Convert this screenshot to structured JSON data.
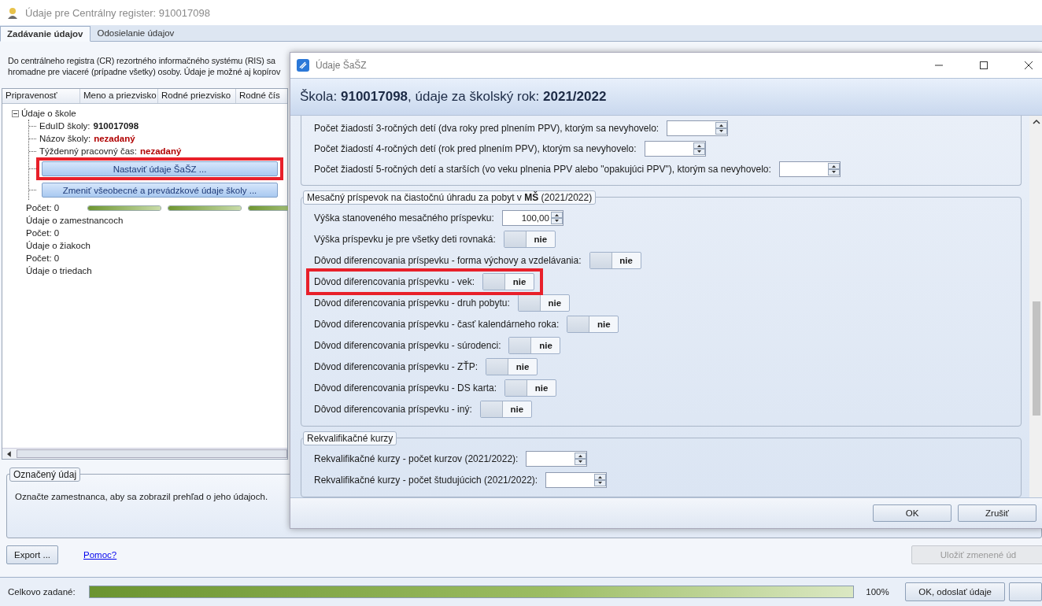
{
  "window": {
    "title": "Údaje pre Centrálny register: 910017098"
  },
  "tabs": [
    {
      "label": "Zadávanie údajov",
      "selected": true
    },
    {
      "label": "Odosielanie údajov",
      "selected": false
    }
  ],
  "description": [
    "Do centrálneho registra (CR) rezortného informačného systému (RIS) sa",
    "hromadne pre viaceré (prípadne všetky) osoby. Údaje je možné aj kopírov"
  ],
  "grid": {
    "columns": [
      "Pripravenosť",
      "Meno a priezvisko",
      "Rodné priezvisko",
      "Rodné čís"
    ],
    "tree": {
      "label": "Údaje o škole",
      "expanded": true,
      "children": [
        {
          "label": "EduID školy:",
          "value": "910017098",
          "missing": false
        },
        {
          "label": "Názov školy:",
          "value": "nezadaný",
          "missing": true
        },
        {
          "label": "Týždenný pracovný čas:",
          "value": "nezadaný",
          "missing": true
        }
      ],
      "buttons": [
        {
          "label": "Nastaviť údaje ŠaŠZ ...",
          "highlighted": true
        },
        {
          "label": "Zmeniť všeobecné a prevádzkové údaje školy ...",
          "highlighted": false
        }
      ]
    },
    "rows": [
      {
        "label": "Počet: 0",
        "bars": [
          {
            "level": 1
          },
          {
            "level": 1
          },
          {
            "level": 1
          }
        ]
      },
      {
        "label": "Údaje o zamestnancoch"
      },
      {
        "label": "Počet: 0"
      },
      {
        "label": "Údaje o žiakoch"
      },
      {
        "label": "Počet: 0"
      },
      {
        "label": "Údaje o triedach"
      }
    ]
  },
  "selected_info": {
    "legend": "Označený údaj",
    "text": "Označte zamestnanca, aby sa zobrazil prehľad o jeho údajoch."
  },
  "actions": {
    "export": "Export ...",
    "help": "Pomoc?",
    "save": {
      "label": "Uložiť zmenené úd",
      "disabled": true
    }
  },
  "status": {
    "label": "Celkovo zadané:",
    "level": 1,
    "reading": "100%",
    "send": "OK, odoslať údaje"
  },
  "dialog": {
    "title": "Údaje ŠaŠZ",
    "heading": "Škola: **910017098**, údaje za školský rok: **2021/2022**",
    "groups": [
      {
        "rows": [
          {
            "kind": "number",
            "label": "Počet žiadostí 3-ročných detí (dva roky pred plnením PPV), ktorým sa nevyhovelo:",
            "value": null,
            "highlighted": false
          },
          {
            "kind": "number",
            "label": "Počet žiadostí 4-ročných detí (rok pred plnením PPV), ktorým sa nevyhovelo:",
            "value": null,
            "highlighted": false
          },
          {
            "kind": "number",
            "label": "Počet žiadostí 5-ročných detí a starších (vo veku plnenia PPV alebo \"opakujúci PPV\"), ktorým sa nevyhovelo:",
            "value": null,
            "highlighted": false
          }
        ]
      },
      {
        "legend": "Mesačný príspevok na čiastočnú úhradu za pobyt v **MŠ** (2021/2022)",
        "rows": [
          {
            "kind": "number",
            "label": "Výška stanoveného mesačného príspevku:",
            "value": "100,00",
            "highlighted": false
          },
          {
            "kind": "toggle",
            "label": "Výška príspevku je pre všetky deti rovnaká:",
            "on": false,
            "text": "nie",
            "highlighted": false
          },
          {
            "kind": "toggle",
            "label": "Dôvod diferencovania príspevku - forma výchovy a vzdelávania:",
            "on": false,
            "text": "nie",
            "highlighted": false
          },
          {
            "kind": "toggle",
            "label": "Dôvod diferencovania príspevku - vek:",
            "on": false,
            "text": "nie",
            "highlighted": true
          },
          {
            "kind": "toggle",
            "label": "Dôvod diferencovania príspevku - druh pobytu:",
            "on": false,
            "text": "nie",
            "highlighted": false
          },
          {
            "kind": "toggle",
            "label": "Dôvod diferencovania príspevku - časť kalendárneho roka:",
            "on": false,
            "text": "nie",
            "highlighted": false
          },
          {
            "kind": "toggle",
            "label": "Dôvod diferencovania príspevku - súrodenci:",
            "on": false,
            "text": "nie",
            "highlighted": false
          },
          {
            "kind": "toggle",
            "label": "Dôvod diferencovania príspevku - ZŤP:",
            "on": false,
            "text": "nie",
            "highlighted": false
          },
          {
            "kind": "toggle",
            "label": "Dôvod diferencovania príspevku - DS karta:",
            "on": false,
            "text": "nie",
            "highlighted": false
          },
          {
            "kind": "toggle",
            "label": "Dôvod diferencovania príspevku - iný:",
            "on": false,
            "text": "nie",
            "highlighted": false
          }
        ]
      },
      {
        "legend": "Rekvalifikačné kurzy",
        "rows": [
          {
            "kind": "number",
            "label": "Rekvalifikačné kurzy - počet kurzov (2021/2022):",
            "value": null,
            "highlighted": false
          },
          {
            "kind": "number",
            "label": "Rekvalifikačné kurzy - počet študujúcich (2021/2022):",
            "value": null,
            "highlighted": false
          }
        ]
      }
    ],
    "buttons": [
      "OK",
      "Zrušiť"
    ]
  }
}
